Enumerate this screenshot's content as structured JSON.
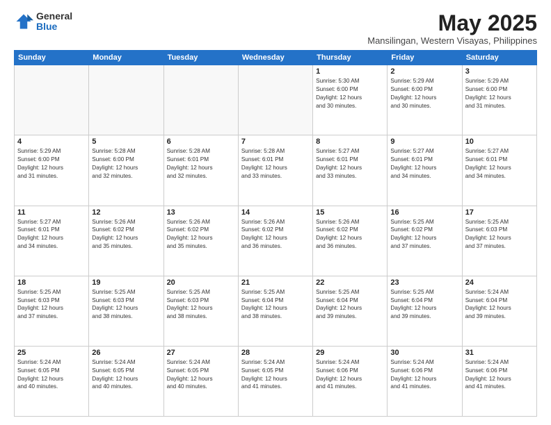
{
  "logo": {
    "general": "General",
    "blue": "Blue"
  },
  "title": "May 2025",
  "location": "Mansilingan, Western Visayas, Philippines",
  "days_of_week": [
    "Sunday",
    "Monday",
    "Tuesday",
    "Wednesday",
    "Thursday",
    "Friday",
    "Saturday"
  ],
  "weeks": [
    [
      {
        "day": "",
        "info": ""
      },
      {
        "day": "",
        "info": ""
      },
      {
        "day": "",
        "info": ""
      },
      {
        "day": "",
        "info": ""
      },
      {
        "day": "1",
        "info": "Sunrise: 5:30 AM\nSunset: 6:00 PM\nDaylight: 12 hours\nand 30 minutes."
      },
      {
        "day": "2",
        "info": "Sunrise: 5:29 AM\nSunset: 6:00 PM\nDaylight: 12 hours\nand 30 minutes."
      },
      {
        "day": "3",
        "info": "Sunrise: 5:29 AM\nSunset: 6:00 PM\nDaylight: 12 hours\nand 31 minutes."
      }
    ],
    [
      {
        "day": "4",
        "info": "Sunrise: 5:29 AM\nSunset: 6:00 PM\nDaylight: 12 hours\nand 31 minutes."
      },
      {
        "day": "5",
        "info": "Sunrise: 5:28 AM\nSunset: 6:00 PM\nDaylight: 12 hours\nand 32 minutes."
      },
      {
        "day": "6",
        "info": "Sunrise: 5:28 AM\nSunset: 6:01 PM\nDaylight: 12 hours\nand 32 minutes."
      },
      {
        "day": "7",
        "info": "Sunrise: 5:28 AM\nSunset: 6:01 PM\nDaylight: 12 hours\nand 33 minutes."
      },
      {
        "day": "8",
        "info": "Sunrise: 5:27 AM\nSunset: 6:01 PM\nDaylight: 12 hours\nand 33 minutes."
      },
      {
        "day": "9",
        "info": "Sunrise: 5:27 AM\nSunset: 6:01 PM\nDaylight: 12 hours\nand 34 minutes."
      },
      {
        "day": "10",
        "info": "Sunrise: 5:27 AM\nSunset: 6:01 PM\nDaylight: 12 hours\nand 34 minutes."
      }
    ],
    [
      {
        "day": "11",
        "info": "Sunrise: 5:27 AM\nSunset: 6:01 PM\nDaylight: 12 hours\nand 34 minutes."
      },
      {
        "day": "12",
        "info": "Sunrise: 5:26 AM\nSunset: 6:02 PM\nDaylight: 12 hours\nand 35 minutes."
      },
      {
        "day": "13",
        "info": "Sunrise: 5:26 AM\nSunset: 6:02 PM\nDaylight: 12 hours\nand 35 minutes."
      },
      {
        "day": "14",
        "info": "Sunrise: 5:26 AM\nSunset: 6:02 PM\nDaylight: 12 hours\nand 36 minutes."
      },
      {
        "day": "15",
        "info": "Sunrise: 5:26 AM\nSunset: 6:02 PM\nDaylight: 12 hours\nand 36 minutes."
      },
      {
        "day": "16",
        "info": "Sunrise: 5:25 AM\nSunset: 6:02 PM\nDaylight: 12 hours\nand 37 minutes."
      },
      {
        "day": "17",
        "info": "Sunrise: 5:25 AM\nSunset: 6:03 PM\nDaylight: 12 hours\nand 37 minutes."
      }
    ],
    [
      {
        "day": "18",
        "info": "Sunrise: 5:25 AM\nSunset: 6:03 PM\nDaylight: 12 hours\nand 37 minutes."
      },
      {
        "day": "19",
        "info": "Sunrise: 5:25 AM\nSunset: 6:03 PM\nDaylight: 12 hours\nand 38 minutes."
      },
      {
        "day": "20",
        "info": "Sunrise: 5:25 AM\nSunset: 6:03 PM\nDaylight: 12 hours\nand 38 minutes."
      },
      {
        "day": "21",
        "info": "Sunrise: 5:25 AM\nSunset: 6:04 PM\nDaylight: 12 hours\nand 38 minutes."
      },
      {
        "day": "22",
        "info": "Sunrise: 5:25 AM\nSunset: 6:04 PM\nDaylight: 12 hours\nand 39 minutes."
      },
      {
        "day": "23",
        "info": "Sunrise: 5:25 AM\nSunset: 6:04 PM\nDaylight: 12 hours\nand 39 minutes."
      },
      {
        "day": "24",
        "info": "Sunrise: 5:24 AM\nSunset: 6:04 PM\nDaylight: 12 hours\nand 39 minutes."
      }
    ],
    [
      {
        "day": "25",
        "info": "Sunrise: 5:24 AM\nSunset: 6:05 PM\nDaylight: 12 hours\nand 40 minutes."
      },
      {
        "day": "26",
        "info": "Sunrise: 5:24 AM\nSunset: 6:05 PM\nDaylight: 12 hours\nand 40 minutes."
      },
      {
        "day": "27",
        "info": "Sunrise: 5:24 AM\nSunset: 6:05 PM\nDaylight: 12 hours\nand 40 minutes."
      },
      {
        "day": "28",
        "info": "Sunrise: 5:24 AM\nSunset: 6:05 PM\nDaylight: 12 hours\nand 41 minutes."
      },
      {
        "day": "29",
        "info": "Sunrise: 5:24 AM\nSunset: 6:06 PM\nDaylight: 12 hours\nand 41 minutes."
      },
      {
        "day": "30",
        "info": "Sunrise: 5:24 AM\nSunset: 6:06 PM\nDaylight: 12 hours\nand 41 minutes."
      },
      {
        "day": "31",
        "info": "Sunrise: 5:24 AM\nSunset: 6:06 PM\nDaylight: 12 hours\nand 41 minutes."
      }
    ]
  ]
}
